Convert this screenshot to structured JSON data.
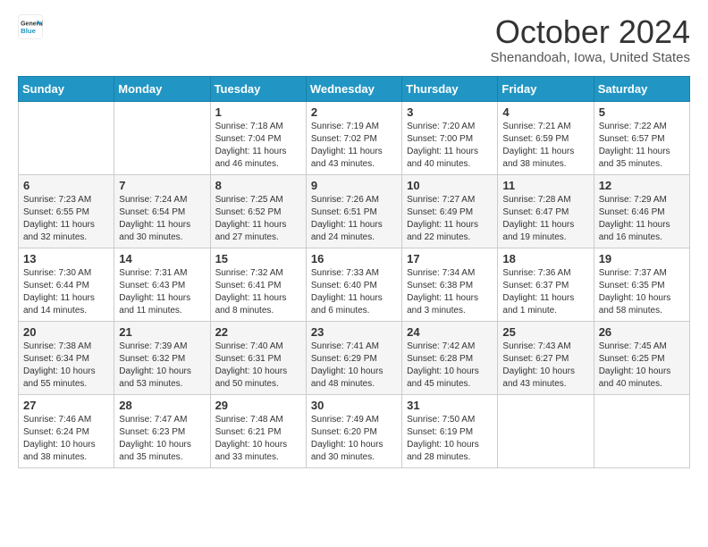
{
  "logo": {
    "general": "General",
    "blue": "Blue"
  },
  "header": {
    "month": "October 2024",
    "location": "Shenandoah, Iowa, United States"
  },
  "days_of_week": [
    "Sunday",
    "Monday",
    "Tuesday",
    "Wednesday",
    "Thursday",
    "Friday",
    "Saturday"
  ],
  "weeks": [
    [
      {
        "day": "",
        "info": ""
      },
      {
        "day": "",
        "info": ""
      },
      {
        "day": "1",
        "info": "Sunrise: 7:18 AM\nSunset: 7:04 PM\nDaylight: 11 hours and 46 minutes."
      },
      {
        "day": "2",
        "info": "Sunrise: 7:19 AM\nSunset: 7:02 PM\nDaylight: 11 hours and 43 minutes."
      },
      {
        "day": "3",
        "info": "Sunrise: 7:20 AM\nSunset: 7:00 PM\nDaylight: 11 hours and 40 minutes."
      },
      {
        "day": "4",
        "info": "Sunrise: 7:21 AM\nSunset: 6:59 PM\nDaylight: 11 hours and 38 minutes."
      },
      {
        "day": "5",
        "info": "Sunrise: 7:22 AM\nSunset: 6:57 PM\nDaylight: 11 hours and 35 minutes."
      }
    ],
    [
      {
        "day": "6",
        "info": "Sunrise: 7:23 AM\nSunset: 6:55 PM\nDaylight: 11 hours and 32 minutes."
      },
      {
        "day": "7",
        "info": "Sunrise: 7:24 AM\nSunset: 6:54 PM\nDaylight: 11 hours and 30 minutes."
      },
      {
        "day": "8",
        "info": "Sunrise: 7:25 AM\nSunset: 6:52 PM\nDaylight: 11 hours and 27 minutes."
      },
      {
        "day": "9",
        "info": "Sunrise: 7:26 AM\nSunset: 6:51 PM\nDaylight: 11 hours and 24 minutes."
      },
      {
        "day": "10",
        "info": "Sunrise: 7:27 AM\nSunset: 6:49 PM\nDaylight: 11 hours and 22 minutes."
      },
      {
        "day": "11",
        "info": "Sunrise: 7:28 AM\nSunset: 6:47 PM\nDaylight: 11 hours and 19 minutes."
      },
      {
        "day": "12",
        "info": "Sunrise: 7:29 AM\nSunset: 6:46 PM\nDaylight: 11 hours and 16 minutes."
      }
    ],
    [
      {
        "day": "13",
        "info": "Sunrise: 7:30 AM\nSunset: 6:44 PM\nDaylight: 11 hours and 14 minutes."
      },
      {
        "day": "14",
        "info": "Sunrise: 7:31 AM\nSunset: 6:43 PM\nDaylight: 11 hours and 11 minutes."
      },
      {
        "day": "15",
        "info": "Sunrise: 7:32 AM\nSunset: 6:41 PM\nDaylight: 11 hours and 8 minutes."
      },
      {
        "day": "16",
        "info": "Sunrise: 7:33 AM\nSunset: 6:40 PM\nDaylight: 11 hours and 6 minutes."
      },
      {
        "day": "17",
        "info": "Sunrise: 7:34 AM\nSunset: 6:38 PM\nDaylight: 11 hours and 3 minutes."
      },
      {
        "day": "18",
        "info": "Sunrise: 7:36 AM\nSunset: 6:37 PM\nDaylight: 11 hours and 1 minute."
      },
      {
        "day": "19",
        "info": "Sunrise: 7:37 AM\nSunset: 6:35 PM\nDaylight: 10 hours and 58 minutes."
      }
    ],
    [
      {
        "day": "20",
        "info": "Sunrise: 7:38 AM\nSunset: 6:34 PM\nDaylight: 10 hours and 55 minutes."
      },
      {
        "day": "21",
        "info": "Sunrise: 7:39 AM\nSunset: 6:32 PM\nDaylight: 10 hours and 53 minutes."
      },
      {
        "day": "22",
        "info": "Sunrise: 7:40 AM\nSunset: 6:31 PM\nDaylight: 10 hours and 50 minutes."
      },
      {
        "day": "23",
        "info": "Sunrise: 7:41 AM\nSunset: 6:29 PM\nDaylight: 10 hours and 48 minutes."
      },
      {
        "day": "24",
        "info": "Sunrise: 7:42 AM\nSunset: 6:28 PM\nDaylight: 10 hours and 45 minutes."
      },
      {
        "day": "25",
        "info": "Sunrise: 7:43 AM\nSunset: 6:27 PM\nDaylight: 10 hours and 43 minutes."
      },
      {
        "day": "26",
        "info": "Sunrise: 7:45 AM\nSunset: 6:25 PM\nDaylight: 10 hours and 40 minutes."
      }
    ],
    [
      {
        "day": "27",
        "info": "Sunrise: 7:46 AM\nSunset: 6:24 PM\nDaylight: 10 hours and 38 minutes."
      },
      {
        "day": "28",
        "info": "Sunrise: 7:47 AM\nSunset: 6:23 PM\nDaylight: 10 hours and 35 minutes."
      },
      {
        "day": "29",
        "info": "Sunrise: 7:48 AM\nSunset: 6:21 PM\nDaylight: 10 hours and 33 minutes."
      },
      {
        "day": "30",
        "info": "Sunrise: 7:49 AM\nSunset: 6:20 PM\nDaylight: 10 hours and 30 minutes."
      },
      {
        "day": "31",
        "info": "Sunrise: 7:50 AM\nSunset: 6:19 PM\nDaylight: 10 hours and 28 minutes."
      },
      {
        "day": "",
        "info": ""
      },
      {
        "day": "",
        "info": ""
      }
    ]
  ]
}
